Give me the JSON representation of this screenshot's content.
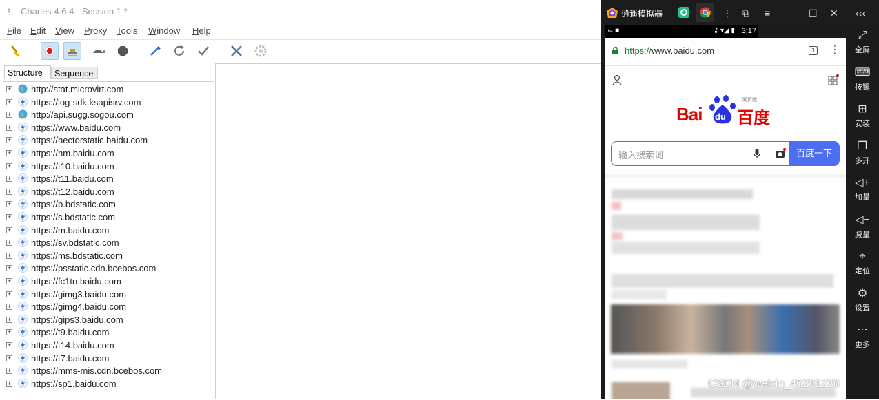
{
  "charles": {
    "title": "Charles 4.6.4 - Session 1 *",
    "menu": [
      {
        "label": "File",
        "u": "F",
        "rest": "ile"
      },
      {
        "label": "Edit",
        "u": "E",
        "rest": "dit"
      },
      {
        "label": "View",
        "u": "V",
        "rest": "iew"
      },
      {
        "label": "Proxy",
        "u": "P",
        "rest": "roxy"
      },
      {
        "label": "Tools",
        "u": "T",
        "rest": "ools"
      },
      {
        "label": "Window",
        "u": "W",
        "rest": "indow"
      },
      {
        "label": "Help",
        "u": "H",
        "rest": "elp"
      }
    ],
    "toolbar": [
      "broom-icon",
      "record-icon",
      "throttle-icon",
      "turtle-icon",
      "stop-icon",
      "pen-icon",
      "refresh-icon",
      "check-icon",
      "tools-icon",
      "settings-icon"
    ],
    "tabs": {
      "structure": "Structure",
      "sequence": "Sequence"
    },
    "hosts": [
      {
        "url": "http://stat.microvirt.com",
        "scheme": "http"
      },
      {
        "url": "https://log-sdk.ksapisrv.com",
        "scheme": "https"
      },
      {
        "url": "http://api.sugg.sogou.com",
        "scheme": "http"
      },
      {
        "url": "https://www.baidu.com",
        "scheme": "https"
      },
      {
        "url": "https://hectorstatic.baidu.com",
        "scheme": "https"
      },
      {
        "url": "https://hm.baidu.com",
        "scheme": "https"
      },
      {
        "url": "https://t10.baidu.com",
        "scheme": "https"
      },
      {
        "url": "https://t11.baidu.com",
        "scheme": "https"
      },
      {
        "url": "https://t12.baidu.com",
        "scheme": "https"
      },
      {
        "url": "https://b.bdstatic.com",
        "scheme": "https"
      },
      {
        "url": "https://s.bdstatic.com",
        "scheme": "https"
      },
      {
        "url": "https://m.baidu.com",
        "scheme": "https"
      },
      {
        "url": "https://sv.bdstatic.com",
        "scheme": "https"
      },
      {
        "url": "https://ms.bdstatic.com",
        "scheme": "https"
      },
      {
        "url": "https://psstatic.cdn.bcebos.com",
        "scheme": "https"
      },
      {
        "url": "https://fc1tn.baidu.com",
        "scheme": "https"
      },
      {
        "url": "https://gimg3.baidu.com",
        "scheme": "https"
      },
      {
        "url": "https://gimg4.baidu.com",
        "scheme": "https"
      },
      {
        "url": "https://gips3.baidu.com",
        "scheme": "https"
      },
      {
        "url": "https://t9.baidu.com",
        "scheme": "https"
      },
      {
        "url": "https://t14.baidu.com",
        "scheme": "https"
      },
      {
        "url": "https://t7.baidu.com",
        "scheme": "https"
      },
      {
        "url": "https://mms-mis.cdn.bcebos.com",
        "scheme": "https"
      },
      {
        "url": "https://sp1.baidu.com",
        "scheme": "https"
      }
    ]
  },
  "emulator": {
    "name": "逍遥模拟器",
    "status": {
      "time": "3:17"
    },
    "browser": {
      "url_scheme": "https://",
      "url_host": "www.baidu.com",
      "tabs_count": "1"
    },
    "baidu": {
      "logo_text_left": "Bai",
      "logo_paw": "du",
      "logo_text_right": "百度",
      "logo_small": "网页版",
      "search_placeholder": "输入搜索词",
      "search_button": "百度一下"
    },
    "side_buttons": [
      {
        "icon": "fullscreen-icon",
        "label": "全屏"
      },
      {
        "icon": "keyboard-icon",
        "label": "按键"
      },
      {
        "icon": "install-icon",
        "label": "安装"
      },
      {
        "icon": "multi-open-icon",
        "label": "多开"
      },
      {
        "icon": "volume-up-icon",
        "label": "加量"
      },
      {
        "icon": "volume-down-icon",
        "label": "减量"
      },
      {
        "icon": "location-icon",
        "label": "定位"
      },
      {
        "icon": "settings-icon",
        "label": "设置"
      },
      {
        "icon": "more-icon",
        "label": "更多"
      }
    ]
  },
  "watermark": "CSDN @weixin_45281236",
  "colors": {
    "baidu_blue": "#4e6ef2",
    "baidu_red": "#e10601",
    "https_green": "#1a7f37"
  }
}
